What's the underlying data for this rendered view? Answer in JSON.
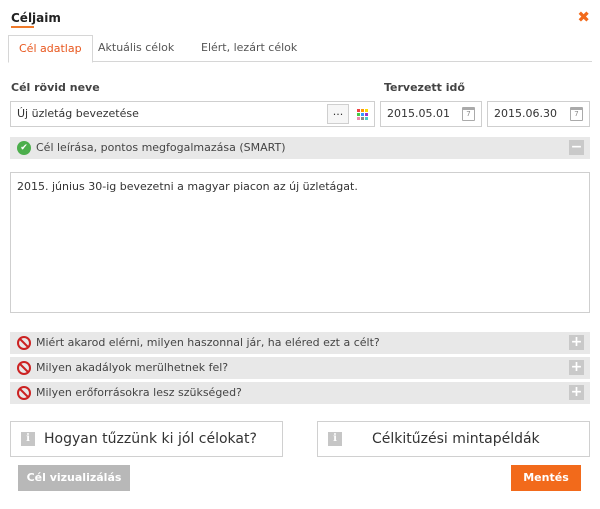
{
  "dialog": {
    "title": "Céljaim"
  },
  "tabs": [
    {
      "label": "Cél adatlap"
    },
    {
      "label": "Aktuális célok"
    },
    {
      "label": "Elért, lezárt célok"
    }
  ],
  "goal_name": {
    "label": "Cél rövid neve",
    "value": "Új üzletág bevezetése",
    "dots_label": "..."
  },
  "planned_time": {
    "label": "Tervezett idő",
    "start": "2015.05.01",
    "end": "2015.06.30"
  },
  "smart_section": {
    "label": "Cél leírása, pontos megfogalmazása (SMART)",
    "text": "2015. június 30-ig bevezetni a magyar piacon az új üzletágat."
  },
  "questions": [
    {
      "label": "Miért akarod elérni, milyen haszonnal jár, ha eléred ezt a célt?"
    },
    {
      "label": "Milyen akadályok merülhetnek fel?"
    },
    {
      "label": "Milyen erőforrásokra lesz szükséged?"
    }
  ],
  "info_buttons": [
    {
      "label": "Hogyan tűzzünk ki jól célokat?"
    },
    {
      "label": "Célkitűzési mintapéldák"
    }
  ],
  "buttons": {
    "visualize": "Cél vizualizálás",
    "save": "Mentés"
  },
  "colors": {
    "accent": "#f26a1b",
    "ok": "#4cae4c",
    "blocked": "#cc2222"
  }
}
